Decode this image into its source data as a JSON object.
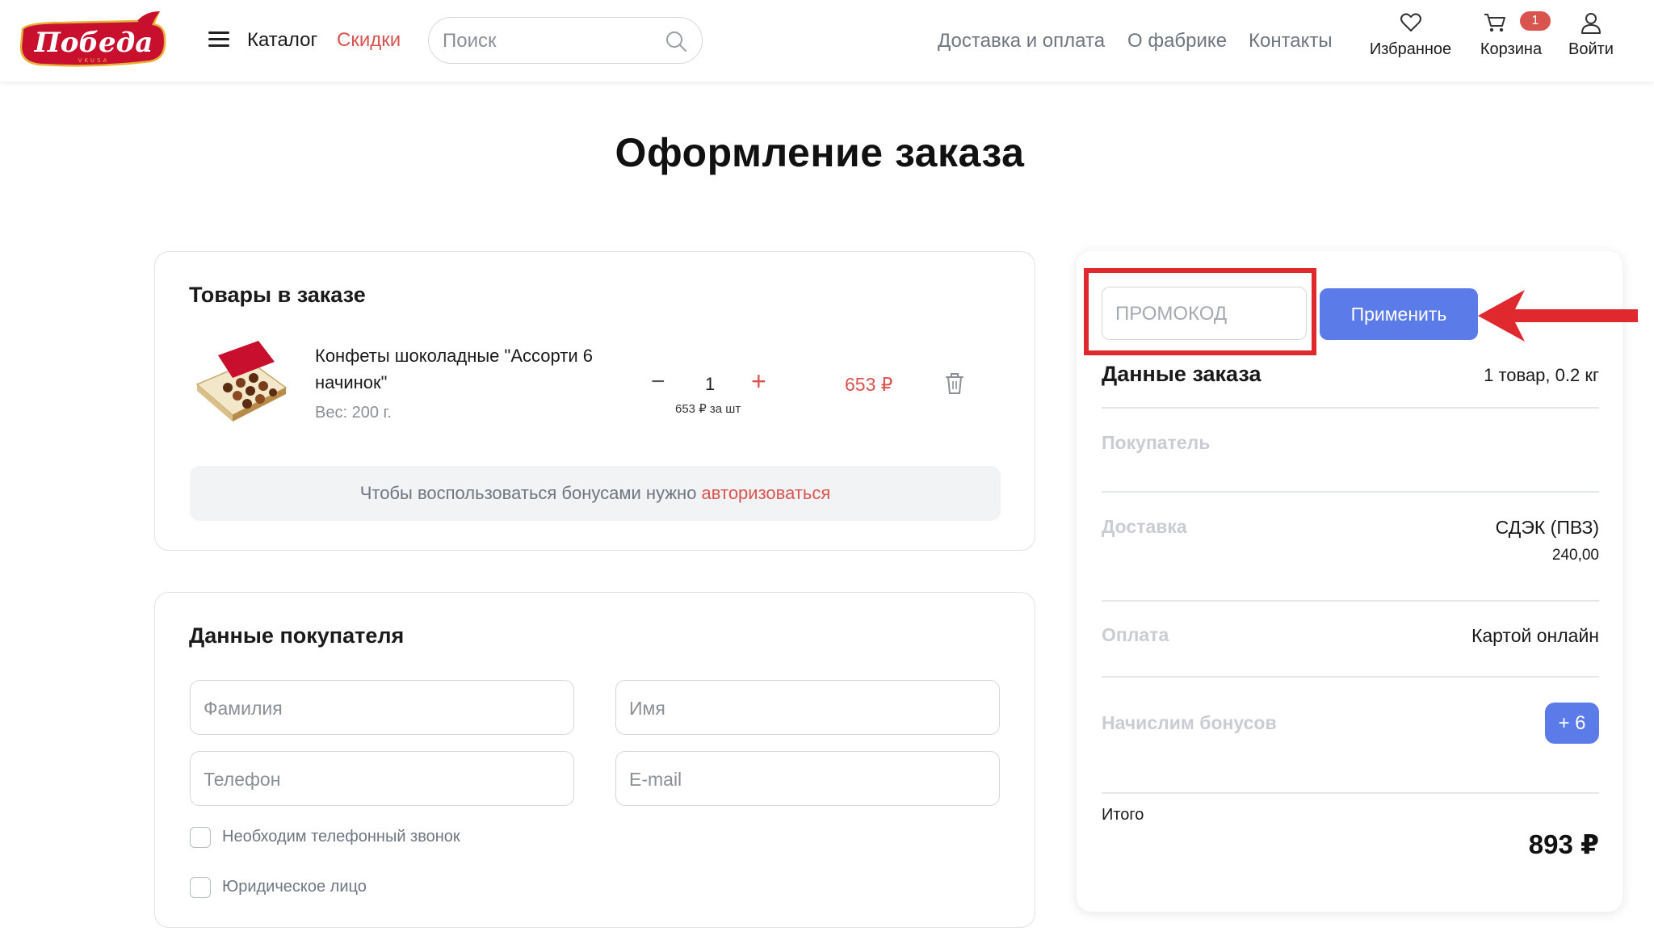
{
  "header": {
    "logo_text": "Победа",
    "logo_subtext": "VKUSA",
    "catalog_label": "Каталог",
    "sale_label": "Скидки",
    "search_placeholder": "Поиск",
    "nav": [
      "Доставка и оплата",
      "О фабрике",
      "Контакты"
    ],
    "favorites_label": "Избранное",
    "cart_label": "Корзина",
    "cart_count": "1",
    "login_label": "Войти"
  },
  "page_title": "Оформление заказа",
  "order_items": {
    "title": "Товары в заказе",
    "item": {
      "name": "Конфеты шоколадные \"Ассорти 6 начинок\"",
      "weight": "Вес: 200 г.",
      "qty": "1",
      "minus": "−",
      "plus": "+",
      "unit_price": "653 ₽ за шт",
      "price": "653 ₽"
    },
    "bonus_text": "Чтобы воспользоваться бонусами нужно ",
    "bonus_link": "авторизоваться"
  },
  "buyer": {
    "title": "Данные покупателя",
    "surname_placeholder": "Фамилия",
    "name_placeholder": "Имя",
    "phone_placeholder": "Телефон",
    "email_placeholder": "E-mail",
    "checkbox_call": "Необходим телефонный звонок",
    "checkbox_legal": "Юридическое лицо"
  },
  "summary": {
    "promo_placeholder": "ПРОМОКОД",
    "apply_label": "Применить",
    "title": "Данные заказа",
    "items_info": "1 товар, 0.2 кг",
    "buyer_label": "Покупатель",
    "delivery_label": "Доставка",
    "delivery_value": "СДЭК (ПВЗ)",
    "delivery_cost": "240,00",
    "payment_label": "Оплата",
    "payment_value": "Картой онлайн",
    "bonus_label": "Начислим бонусов",
    "bonus_value": "+ 6",
    "total_label": "Итого",
    "total_value": "893 ₽"
  },
  "colors": {
    "brand_red": "#d9534f",
    "accent_blue": "#5b7be9",
    "highlight_red": "#e0282f"
  }
}
